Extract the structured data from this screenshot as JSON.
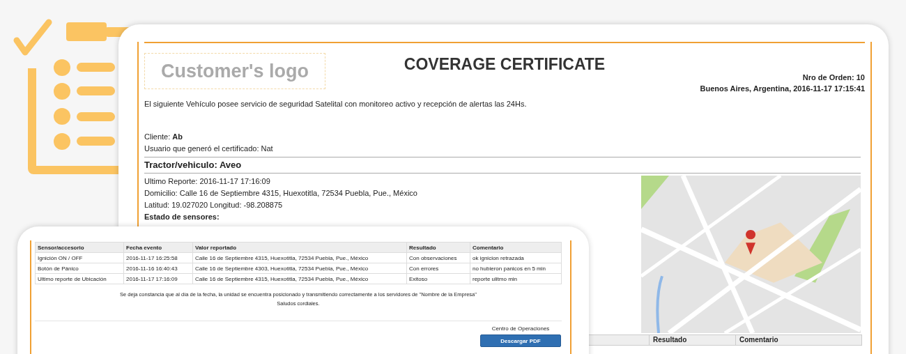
{
  "certificate": {
    "logo_placeholder": "Customer's logo",
    "title": "COVERAGE CERTIFICATE",
    "order_number": "Nro de Orden: 10",
    "place_date": "Buenos Aires, Argentina, 2016-11-17 17:15:41",
    "intro": "El siguiente Vehículo posee servicio de seguridad Satelital con monitoreo activo y recepción de alertas las 24Hs.",
    "client": "Cliente: **Ab**",
    "user": "Usuario que generó el certificado: Nat",
    "vehicle": "Tractor/vehiculo: Aveo",
    "vehicle_lines": [
      "Ultimo Reporte: 2016-11-17 17:16:09",
      "Domicilio: Calle 16 de Septiembre 4315, Huexotitla, 72534 Puebla, Pue., México",
      "Latitud: 19.027020 Longitud: -98.208875"
    ],
    "sensors_heading": "Estado de sensores:",
    "table_columns_visible": [
      "Resultado",
      "Comentario"
    ]
  },
  "report": {
    "columns": [
      "Sensor/accesorio",
      "Fecha evento",
      "Valor reportado",
      "Resultado",
      "Comentario"
    ],
    "rows": [
      [
        "Ignición ON / OFF",
        "2016-11-17 16:25:58",
        "Calle 16 de Septiembre 4315, Huexotitla, 72534 Puebla, Pue., México",
        "Con observaciones",
        "ok ignicion retrazada"
      ],
      [
        "Botón de Pánico",
        "2016-11-16 16:40:43",
        "Calle 16 de Septiembre 4303, Huexotitla, 72534 Puebla, Pue., México",
        "Con errores",
        "no hubieron panicos en 5 min"
      ],
      [
        "Ultimo reporte de Ubicación",
        "2016-11-17 17:16:09",
        "Calle 16 de Septiembre 4315, Huexotitla, 72534 Puebla, Pue., México",
        "Exitoso",
        "reporte ulitmo min"
      ]
    ],
    "statement": "Se deja constancia que al día de la fecha, la unidad se encuentra posicionado y transmitiendo correctamente a los servidores de \"Nombre de la Empresa\"",
    "closing": "Saludos cordiales.",
    "signature": "Centro de Operaciones",
    "download_button": "Descargar PDF"
  }
}
